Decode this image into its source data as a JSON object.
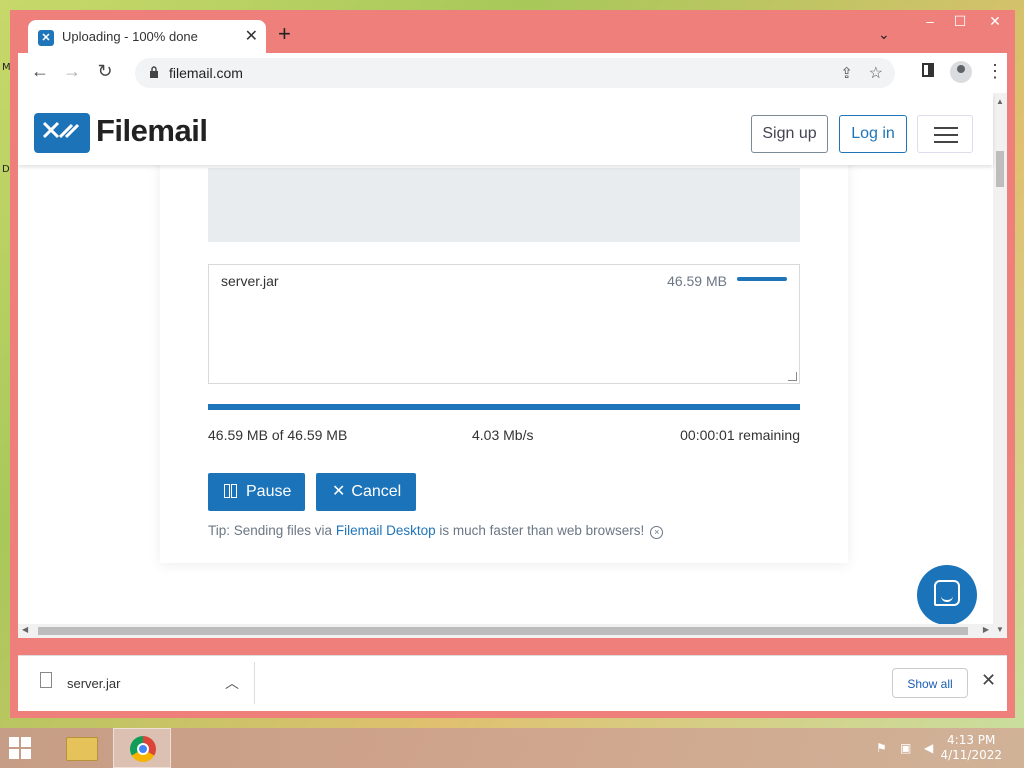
{
  "desktop": {
    "edge_text_1": "M",
    "edge_text_2": "D"
  },
  "browser": {
    "tab_title": "Uploading - 100% done",
    "tab_close": "✕",
    "new_tab": "+",
    "tab_search": "⌄",
    "window_controls": {
      "minimize": "–",
      "maximize": "☐",
      "close": "✕"
    },
    "nav": {
      "back": "←",
      "forward": "→",
      "reload": "↻"
    },
    "url": "filemail.com",
    "menu": "⋮"
  },
  "site": {
    "logo_text": "Filemail",
    "signup": "Sign up",
    "login": "Log in"
  },
  "upload": {
    "file_name": "server.jar",
    "file_size": "46.59 MB",
    "progress_fraction": 1.0,
    "transferred": "46.59 MB of 46.59 MB",
    "speed": "4.03 Mb/s",
    "remaining": "00:00:01 remaining",
    "pause_label": "Pause",
    "cancel_label": "Cancel",
    "cancel_icon": "✕",
    "tip_prefix": "Tip: Sending files via ",
    "tip_link": "Filemail Desktop",
    "tip_suffix": " is much faster than web browsers!",
    "tip_close": "×"
  },
  "scroll": {
    "up": "▲",
    "down": "▼",
    "left": "◀",
    "right": "▶"
  },
  "download_shelf": {
    "file_name": "server.jar",
    "chevron": "︿",
    "show_all": "Show all",
    "close": "✕"
  },
  "taskbar": {
    "time": "4:13 PM",
    "date": "4/11/2022"
  },
  "colors": {
    "accent": "#1b74ba",
    "window_frame": "#ee7f7a"
  }
}
